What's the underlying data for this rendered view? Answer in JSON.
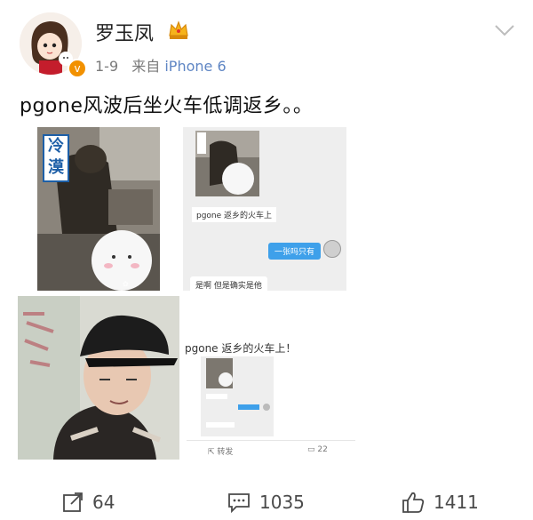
{
  "user": {
    "name": "罗玉凤",
    "date": "1-9",
    "source_prefix": "来自",
    "source_device": "iPhone 6"
  },
  "post": {
    "text": "pgone风波后坐火车低调返乡。。"
  },
  "images": {
    "img1": {
      "tag_text": "冷漠"
    },
    "img2": {
      "caption": "pgone 返乡的火车上",
      "bubble_blue": "一张吗只有",
      "bubble_left": "是啊 但是确实是他"
    },
    "img4": {
      "caption": "pgone 返乡的火车上！",
      "action_repost": "转发",
      "action_comment_count": "22"
    }
  },
  "actions": {
    "share_count": "64",
    "comment_count": "1035",
    "like_count": "1411"
  },
  "colors": {
    "link_blue": "#5f86c4",
    "badge_orange": "#f29100",
    "chat_blue": "#3ea0ea"
  }
}
